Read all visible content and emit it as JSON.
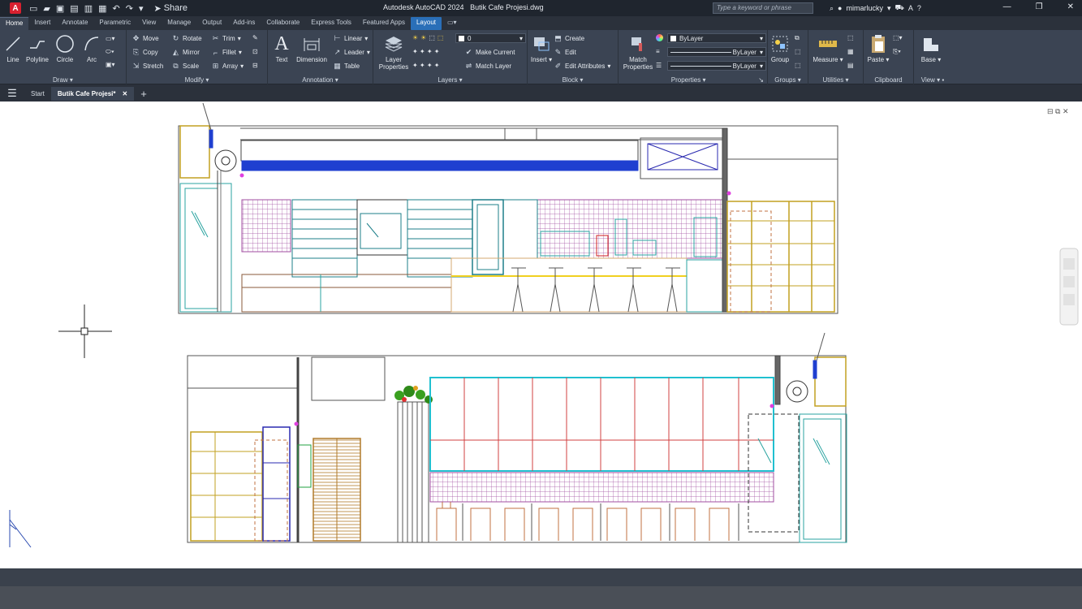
{
  "app": {
    "title": "Autodesk AutoCAD 2024",
    "file": "Butik Cafe Projesi.dwg",
    "icon_letter": "A",
    "share_label": "Share",
    "search_placeholder": "Type a keyword or phrase",
    "user": "mimarlucky"
  },
  "ribbon_tabs": [
    "Home",
    "Insert",
    "Annotate",
    "Parametric",
    "View",
    "Manage",
    "Output",
    "Add-ins",
    "Collaborate",
    "Express Tools",
    "Featured Apps",
    "Layout"
  ],
  "panels": {
    "draw": {
      "title": "Draw",
      "line": "Line",
      "polyline": "Polyline",
      "circle": "Circle",
      "arc": "Arc"
    },
    "modify": {
      "title": "Modify",
      "move": "Move",
      "rotate": "Rotate",
      "trim": "Trim",
      "copy": "Copy",
      "mirror": "Mirror",
      "fillet": "Fillet",
      "stretch": "Stretch",
      "scale": "Scale",
      "array": "Array"
    },
    "annotation": {
      "title": "Annotation",
      "text": "Text",
      "dimension": "Dimension",
      "linear": "Linear",
      "leader": "Leader",
      "table": "Table"
    },
    "layers": {
      "title": "Layers",
      "layer_properties_1": "Layer",
      "layer_properties_2": "Properties",
      "current_layer": "0",
      "make_current": "Make Current",
      "match_layer": "Match Layer"
    },
    "block": {
      "title": "Block",
      "insert": "Insert",
      "create": "Create",
      "edit": "Edit",
      "edit_attributes": "Edit Attributes"
    },
    "properties": {
      "title": "Properties",
      "match_1": "Match",
      "match_2": "Properties",
      "color": "ByLayer",
      "linetype": "ByLayer",
      "lineweight": "ByLayer"
    },
    "groups": {
      "title": "Groups",
      "group": "Group"
    },
    "utilities": {
      "title": "Utilities",
      "measure": "Measure"
    },
    "clipboard": {
      "title": "Clipboard",
      "paste": "Paste"
    },
    "view": {
      "title": "View",
      "base": "Base"
    }
  },
  "doc_tabs": {
    "start": "Start",
    "active": "Butik Cafe Projesi*"
  },
  "colors": {
    "accent": "#2a6fb8",
    "ribbon": "#3b4453",
    "canvas": "#ffffff"
  }
}
